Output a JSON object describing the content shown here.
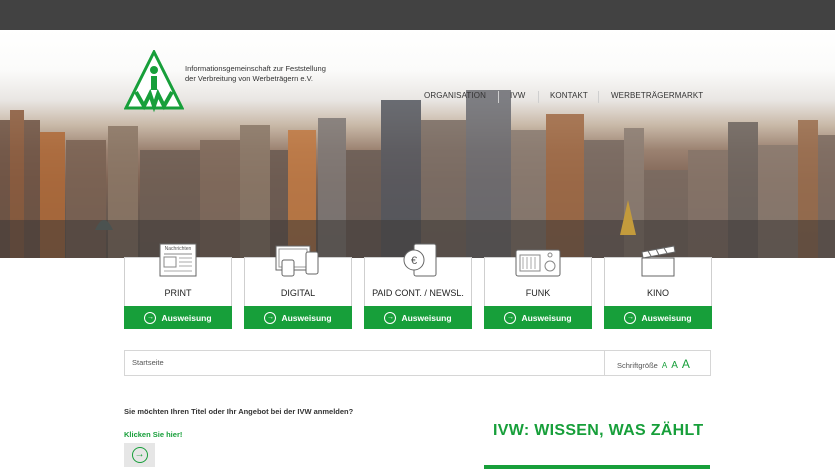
{
  "header": {
    "org_name_line1": "Informationsgemeinschaft zur Feststellung",
    "org_name_line2": "der Verbreitung von Werbeträgern e.V.",
    "logo_text": "IVW"
  },
  "nav": {
    "items": [
      "ORGANISATION",
      "IVW",
      "KONTAKT",
      "WERBETRÄGERMARKT"
    ]
  },
  "cards": [
    {
      "label": "PRINT",
      "button": "Ausweisung",
      "icon": "newspaper-icon",
      "icon_text": "Nachrichten"
    },
    {
      "label": "DIGITAL",
      "button": "Ausweisung",
      "icon": "devices-icon"
    },
    {
      "label": "PAID CONT. / NEWSL.",
      "button": "Ausweisung",
      "icon": "euro-icon",
      "icon_text": "€"
    },
    {
      "label": "FUNK",
      "button": "Ausweisung",
      "icon": "radio-icon"
    },
    {
      "label": "KINO",
      "button": "Ausweisung",
      "icon": "clapperboard-icon"
    }
  ],
  "breadcrumb": {
    "current": "Startseite",
    "fontsize_label": "Schriftgröße",
    "fontsize_options": [
      "A",
      "A",
      "A"
    ]
  },
  "register": {
    "question": "Sie möchten Ihren Titel oder Ihr Angebot bei der IVW anmelden?",
    "link": "Klicken Sie hier!"
  },
  "slogan": "IVW: WISSEN, WAS ZÄHLT",
  "colors": {
    "accent": "#179f3a",
    "topbar": "#424242"
  }
}
